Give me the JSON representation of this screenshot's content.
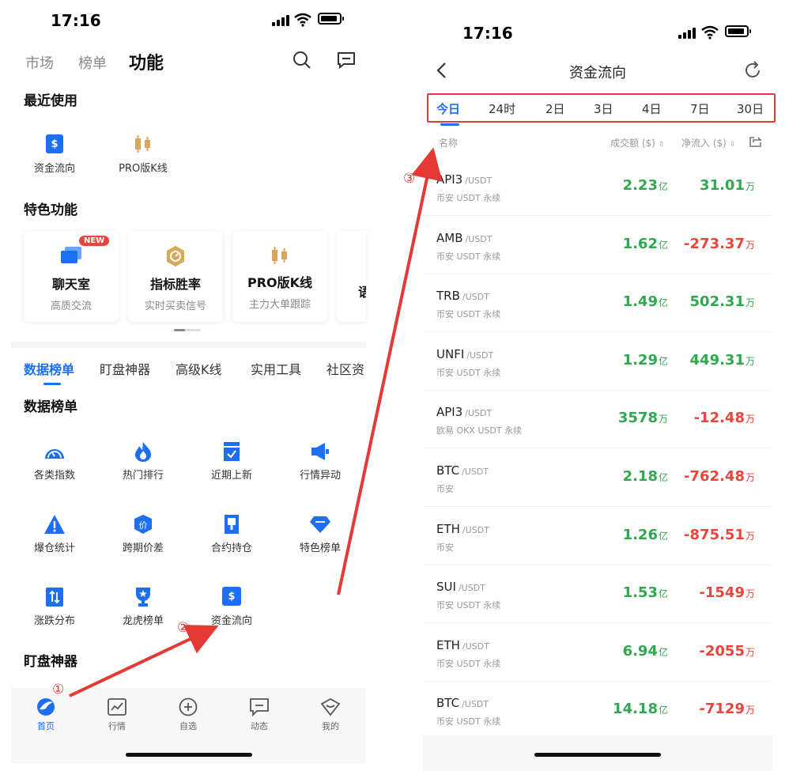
{
  "colors": {
    "accent": "#1c6ef2",
    "positive": "#2fa84f",
    "negative": "#e8453c",
    "annotation": "#e53935",
    "gold": "#d8a85a"
  },
  "left": {
    "status_time": "17:16",
    "top_tabs": [
      "市场",
      "榜单",
      "功能"
    ],
    "recent_title": "最近使用",
    "recent_items": [
      {
        "label": "资金流向",
        "icon": "dollar-icon"
      },
      {
        "label": "PRO版K线",
        "icon": "candlestick-icon"
      }
    ],
    "featured_title": "特色功能",
    "cards": [
      {
        "title": "聊天室",
        "subtitle": "高质交流",
        "badge": "NEW",
        "icon": "chat-icon"
      },
      {
        "title": "指标胜率",
        "subtitle": "实时买卖信号",
        "icon": "target-icon"
      },
      {
        "title": "PRO版K线",
        "subtitle": "主力大单跟踪",
        "icon": "candlestick-icon"
      },
      {
        "title": "语",
        "subtitle": "",
        "icon": ""
      }
    ],
    "sub_tabs": [
      "数据榜单",
      "盯盘神器",
      "高级K线",
      "实用工具",
      "社区资"
    ],
    "data_title": "数据榜单",
    "grid": [
      {
        "label": "各类指数",
        "icon": "gauge-icon"
      },
      {
        "label": "热门排行",
        "icon": "flame-icon"
      },
      {
        "label": "近期上新",
        "icon": "calendar-check-icon"
      },
      {
        "label": "行情异动",
        "icon": "megaphone-icon"
      },
      {
        "label": "爆仓统计",
        "icon": "warning-icon"
      },
      {
        "label": "跨期价差",
        "icon": "price-shield-icon"
      },
      {
        "label": "合约持仓",
        "icon": "contract-icon"
      },
      {
        "label": "特色榜单",
        "icon": "diamond-icon"
      },
      {
        "label": "涨跌分布",
        "icon": "updown-icon"
      },
      {
        "label": "龙虎榜单",
        "icon": "trophy-icon"
      },
      {
        "label": "资金流向",
        "icon": "dollar-icon"
      }
    ],
    "watch_title": "盯盘神器",
    "bottom_nav": [
      {
        "label": "首页",
        "icon": "home-icon"
      },
      {
        "label": "行情",
        "icon": "chart-icon"
      },
      {
        "label": "自选",
        "icon": "plus-circle-icon"
      },
      {
        "label": "动态",
        "icon": "message-icon"
      },
      {
        "label": "我的",
        "icon": "profile-icon"
      }
    ]
  },
  "right": {
    "status_time": "17:16",
    "title": "资金流向",
    "timeframes": [
      "今日",
      "24时",
      "2日",
      "3日",
      "4日",
      "7日",
      "30日"
    ],
    "col_name": "名称",
    "col_volume": "成交额 ($)",
    "col_netflow": "净流入 ($)",
    "rows": [
      {
        "symbol": "API3",
        "quote": "/USDT",
        "exchange": "币安 USDT 永续",
        "volume": "2.23",
        "volume_unit": "亿",
        "net": "31.01",
        "net_unit": "万",
        "net_sign": "pos"
      },
      {
        "symbol": "AMB",
        "quote": "/USDT",
        "exchange": "币安 USDT 永续",
        "volume": "1.62",
        "volume_unit": "亿",
        "net": "-273.37",
        "net_unit": "万",
        "net_sign": "neg"
      },
      {
        "symbol": "TRB",
        "quote": "/USDT",
        "exchange": "币安 USDT 永续",
        "volume": "1.49",
        "volume_unit": "亿",
        "net": "502.31",
        "net_unit": "万",
        "net_sign": "pos"
      },
      {
        "symbol": "UNFI",
        "quote": "/USDT",
        "exchange": "币安 USDT 永续",
        "volume": "1.29",
        "volume_unit": "亿",
        "net": "449.31",
        "net_unit": "万",
        "net_sign": "pos"
      },
      {
        "symbol": "API3",
        "quote": "/USDT",
        "exchange": "欧易 OKX USDT 永续",
        "volume": "3578",
        "volume_unit": "万",
        "net": "-12.48",
        "net_unit": "万",
        "net_sign": "neg"
      },
      {
        "symbol": "BTC",
        "quote": "/USDT",
        "exchange": "币安",
        "volume": "2.18",
        "volume_unit": "亿",
        "net": "-762.48",
        "net_unit": "万",
        "net_sign": "neg"
      },
      {
        "symbol": "ETH",
        "quote": "/USDT",
        "exchange": "币安",
        "volume": "1.26",
        "volume_unit": "亿",
        "net": "-875.51",
        "net_unit": "万",
        "net_sign": "neg"
      },
      {
        "symbol": "SUI",
        "quote": "/USDT",
        "exchange": "币安 USDT 永续",
        "volume": "1.53",
        "volume_unit": "亿",
        "net": "-1549",
        "net_unit": "万",
        "net_sign": "neg"
      },
      {
        "symbol": "ETH",
        "quote": "/USDT",
        "exchange": "币安 USDT 永续",
        "volume": "6.94",
        "volume_unit": "亿",
        "net": "-2055",
        "net_unit": "万",
        "net_sign": "neg"
      },
      {
        "symbol": "BTC",
        "quote": "/USDT",
        "exchange": "币安 USDT 永续",
        "volume": "14.18",
        "volume_unit": "亿",
        "net": "-7129",
        "net_unit": "万",
        "net_sign": "neg"
      }
    ]
  },
  "annotations": {
    "step1": "①",
    "step2": "②",
    "step3": "③"
  }
}
